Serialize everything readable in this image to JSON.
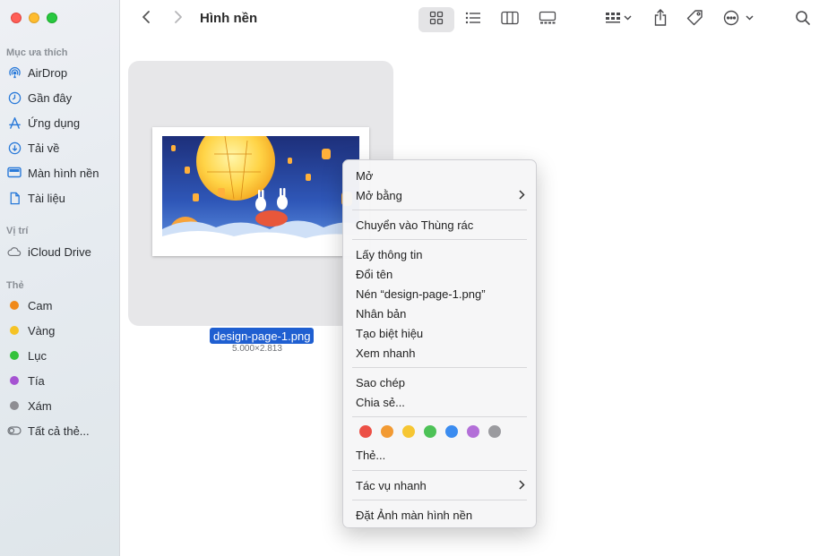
{
  "window": {
    "title": "Hình nền"
  },
  "sidebar": {
    "favorites_header": "Mục ưa thích",
    "favorites": [
      {
        "label": "AirDrop",
        "icon": "airdrop-icon"
      },
      {
        "label": "Gần đây",
        "icon": "clock-icon"
      },
      {
        "label": "Ứng dụng",
        "icon": "applications-icon"
      },
      {
        "label": "Tải về",
        "icon": "download-icon"
      },
      {
        "label": "Màn hình nền",
        "icon": "desktop-icon"
      },
      {
        "label": "Tài liệu",
        "icon": "document-icon"
      }
    ],
    "locations_header": "Vị trí",
    "locations": [
      {
        "label": "iCloud Drive",
        "icon": "cloud-icon"
      }
    ],
    "tags_header": "Thẻ",
    "tags": [
      {
        "label": "Cam",
        "color": "#f0891a"
      },
      {
        "label": "Vàng",
        "color": "#f5c325"
      },
      {
        "label": "Lục",
        "color": "#34c23c"
      },
      {
        "label": "Tía",
        "color": "#a553d2"
      },
      {
        "label": "Xám",
        "color": "#8e8e93"
      },
      {
        "label": "Tất cả thẻ...",
        "icon": "all-tags-icon"
      }
    ]
  },
  "file": {
    "name": "design-page-1.png",
    "dimensions": "5.000×2.813"
  },
  "context_menu": {
    "items": {
      "open": "Mở",
      "open_with": "Mở bằng",
      "move_to_trash": "Chuyển vào Thùng rác",
      "get_info": "Lấy thông tin",
      "rename": "Đổi tên",
      "compress": "Nén “design-page-1.png”",
      "duplicate": "Nhân bản",
      "make_alias": "Tạo biệt hiệu",
      "quick_look": "Xem nhanh",
      "copy": "Sao chép",
      "share": "Chia sẻ...",
      "tags": "Thẻ...",
      "quick_actions": "Tác vụ nhanh",
      "set_desktop_picture": "Đặt Ảnh màn hình nền"
    },
    "tag_colors": [
      "#ec5046",
      "#f29a33",
      "#f6c633",
      "#4dc257",
      "#3b8cf0",
      "#b36fd8",
      "#9b9b9f"
    ]
  },
  "colors": {
    "accent": "#1f5fd1",
    "sidebar_icon": "#2a7ad9"
  }
}
